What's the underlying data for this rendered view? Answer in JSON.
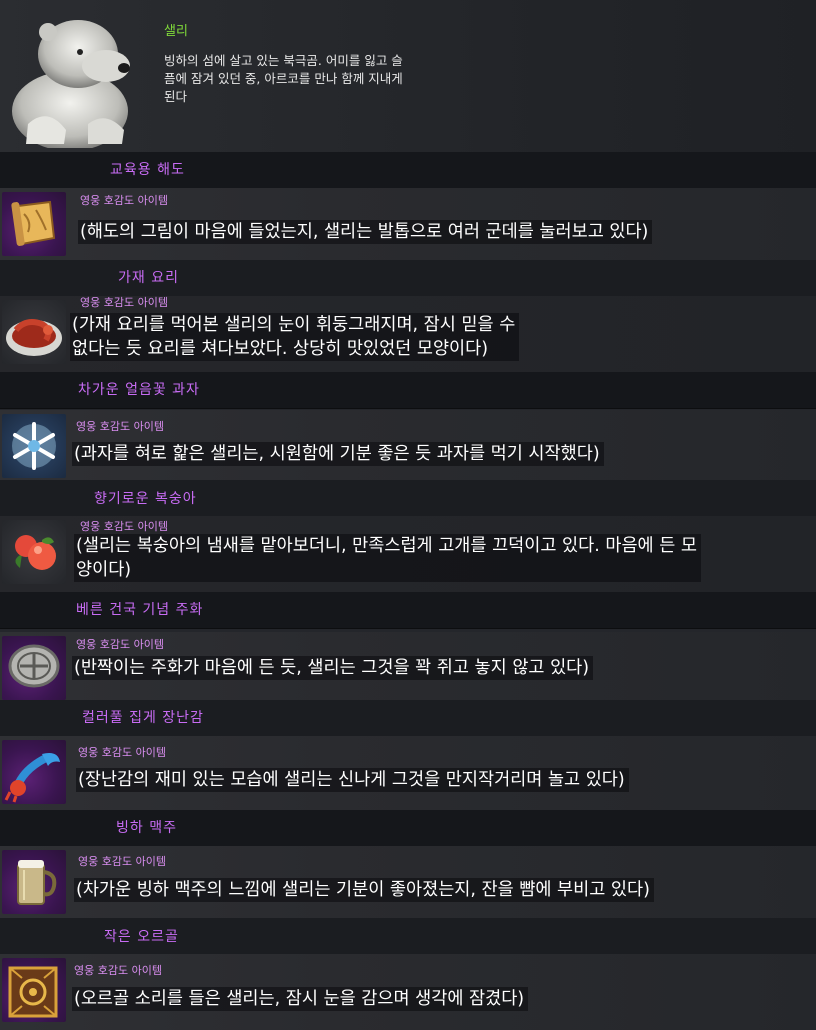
{
  "npc": {
    "name": "샐리",
    "description_lines": [
      "빙하의 섬에 살고 있는 북극곰. 어미를 잃고 슬",
      "픔에 잠겨 있던 중, 아르코를 만나 함께 지내게",
      "된다"
    ]
  },
  "items": [
    {
      "title": "교육용 해도",
      "grade": "영웅 호감도 아이템",
      "lines": [
        "(해도의 그림이 마음에 들었는지, 샐리는 발톱으로 여러 군데를 눌러보고 있다)"
      ],
      "icon": "map-scroll-icon"
    },
    {
      "title": "가재 요리",
      "grade": "영웅 호감도 아이템",
      "lines": [
        "(가재 요리를 먹어본 샐리의 눈이 휘둥그래지며, 잠시 믿을 수",
        "없다는 듯 요리를 쳐다보았다. 상당히 맛있었던 모양이다)"
      ],
      "icon": "crayfish-dish-icon"
    },
    {
      "title": "차가운 얼음꽃 과자",
      "grade": "영웅 호감도 아이템",
      "lines": [
        "(과자를 혀로 핥은 샐리는, 시원함에 기분 좋은 듯 과자를 먹기 시작했다)"
      ],
      "icon": "snowflake-cookie-icon"
    },
    {
      "title": "향기로운 복숭아",
      "grade": "영웅 호감도 아이템",
      "lines": [
        "(샐리는 복숭아의 냄새를 맡아보더니, 만족스럽게 고개를 끄덕이고 있다. 마음에 든 모",
        "양이다)"
      ],
      "icon": "peach-icon"
    },
    {
      "title": "베른 건국 기념 주화",
      "grade": "영웅 호감도 아이템",
      "lines": [
        "(반짝이는 주화가 마음에 든 듯, 샐리는 그것을 꽉 쥐고 놓지 않고 있다)"
      ],
      "icon": "coin-icon"
    },
    {
      "title": "컬러풀 집게 장난감",
      "grade": "영웅 호감도 아이템",
      "lines": [
        "(장난감의 재미 있는 모습에 샐리는 신나게 그것을 만지작거리며 놀고 있다)"
      ],
      "icon": "claw-toy-icon"
    },
    {
      "title": "빙하 맥주",
      "grade": "영웅 호감도 아이템",
      "lines": [
        "(차가운 빙하 맥주의 느낌에 샐리는 기분이 좋아졌는지, 잔을 뺨에 부비고 있다)"
      ],
      "icon": "beer-mug-icon"
    },
    {
      "title": "작은 오르골",
      "grade": "영웅 호감도 아이템",
      "lines": [
        "(오르골 소리를 들은 샐리는, 잠시 눈을 감으며 생각에 잠겼다)"
      ],
      "icon": "music-box-icon"
    }
  ],
  "colors": {
    "title": "#c86cf4",
    "grade": "#d98ef0",
    "npc_name": "#7fd93a"
  }
}
